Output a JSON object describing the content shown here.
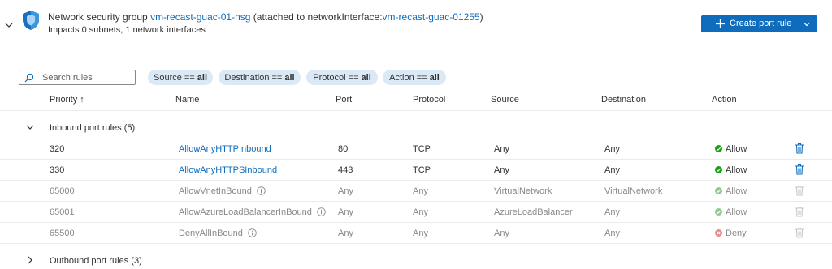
{
  "header": {
    "title_prefix": "Network security group",
    "nsg_name": "vm-recast-guac-01-nsg",
    "attached_prefix": "(attached to networkInterface:",
    "nic_name": "vm-recast-guac-01255",
    "attached_suffix": ")",
    "subtitle": "Impacts 0 subnets, 1 network interfaces"
  },
  "toolbar": {
    "create_label": "Create port rule"
  },
  "search": {
    "placeholder": "Search rules"
  },
  "filters": [
    {
      "key": "Source ==",
      "value": "all"
    },
    {
      "key": "Destination ==",
      "value": "all"
    },
    {
      "key": "Protocol ==",
      "value": "all"
    },
    {
      "key": "Action ==",
      "value": "all"
    }
  ],
  "columns": {
    "priority": "Priority ↑",
    "name": "Name",
    "port": "Port",
    "protocol": "Protocol",
    "source": "Source",
    "destination": "Destination",
    "action": "Action"
  },
  "inbound": {
    "label": "Inbound port rules (5)",
    "rows": [
      {
        "priority": "320",
        "name": "AllowAnyHTTPInbound",
        "port": "80",
        "protocol": "TCP",
        "source": "Any",
        "destination": "Any",
        "action": "Allow"
      },
      {
        "priority": "330",
        "name": "AllowAnyHTTPSInbound",
        "port": "443",
        "protocol": "TCP",
        "source": "Any",
        "destination": "Any",
        "action": "Allow"
      },
      {
        "priority": "65000",
        "name": "AllowVnetInBound",
        "port": "Any",
        "protocol": "Any",
        "source": "VirtualNetwork",
        "destination": "VirtualNetwork",
        "action": "Allow"
      },
      {
        "priority": "65001",
        "name": "AllowAzureLoadBalancerInBound",
        "port": "Any",
        "protocol": "Any",
        "source": "AzureLoadBalancer",
        "destination": "Any",
        "action": "Allow"
      },
      {
        "priority": "65500",
        "name": "DenyAllInBound",
        "port": "Any",
        "protocol": "Any",
        "source": "Any",
        "destination": "Any",
        "action": "Deny"
      }
    ]
  },
  "outbound": {
    "label": "Outbound port rules (3)"
  },
  "colors": {
    "accent": "#0f6cbd",
    "allow": "#13a10e",
    "deny": "#d13438",
    "pill_bg": "#dbe8f6"
  }
}
